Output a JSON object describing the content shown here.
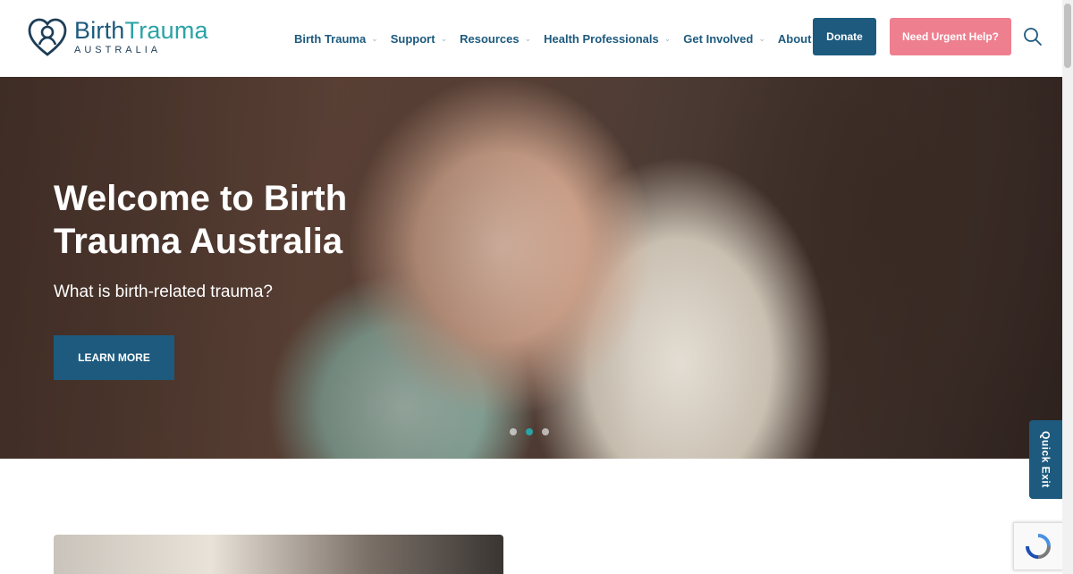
{
  "brand": {
    "name_part1": "Birth",
    "name_part2": "Trauma",
    "tagline": "AUSTRALIA"
  },
  "nav": {
    "items": [
      {
        "label": "Birth Trauma",
        "has_dropdown": true
      },
      {
        "label": "Support",
        "has_dropdown": true
      },
      {
        "label": "Resources",
        "has_dropdown": true
      },
      {
        "label": "Health Professionals",
        "has_dropdown": true
      },
      {
        "label": "Get Involved",
        "has_dropdown": true
      },
      {
        "label": "About Us",
        "has_dropdown": true
      }
    ],
    "donate_label": "Donate",
    "urgent_label": "Need Urgent Help?",
    "search_icon": "search-icon"
  },
  "hero": {
    "title": "Welcome to Birth Trauma Australia",
    "subtitle": "What is birth-related trauma?",
    "cta_label": "LEARN MORE",
    "slides": 3,
    "active_slide": 2
  },
  "quick_exit": {
    "label": "Quick Exit"
  },
  "colors": {
    "primary": "#1d5a7e",
    "teal": "#2aa3a6",
    "urgent": "#ee7f8f"
  }
}
